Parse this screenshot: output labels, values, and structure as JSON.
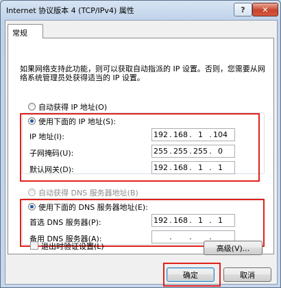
{
  "window": {
    "title": "Internet 协议版本 4 (TCP/IPv4) 属性",
    "help_glyph": "?",
    "close_glyph": "✕"
  },
  "tabs": [
    {
      "label": "常规"
    }
  ],
  "description": "如果网络支持此功能，则可以获取自动指派的 IP 设置。否则，您需要从网络系统管理员处获得适当的 IP 设置。",
  "ip_section": {
    "auto_option": "自动获得 IP 地址(O)",
    "manual_option": "使用下面的 IP 地址(S):",
    "selected": "manual",
    "fields": [
      {
        "label": "IP 地址(I):",
        "octets": [
          "192",
          "168",
          "1",
          "104"
        ]
      },
      {
        "label": "子网掩码(U):",
        "octets": [
          "255",
          "255",
          "255",
          "0"
        ]
      },
      {
        "label": "默认网关(D):",
        "octets": [
          "192",
          "168",
          "1",
          "1"
        ]
      }
    ]
  },
  "dns_section": {
    "auto_option": "自动获得 DNS 服务器地址(B)",
    "manual_option": "使用下面的 DNS 服务器地址(E):",
    "selected": "manual",
    "fields": [
      {
        "label": "首选 DNS 服务器(P):",
        "octets": [
          "192",
          "168",
          "1",
          "1"
        ]
      },
      {
        "label": "备用 DNS 服务器(A):",
        "octets": [
          "",
          "",
          "",
          ""
        ]
      }
    ]
  },
  "validate_on_exit": {
    "label": "退出时验证设置(L)",
    "checked": false
  },
  "buttons": {
    "advanced": "高级(V)...",
    "ok": "确定",
    "cancel": "取消"
  },
  "colors": {
    "highlight_box": "#e0201a",
    "radio_dot": "#1d5aa6"
  }
}
